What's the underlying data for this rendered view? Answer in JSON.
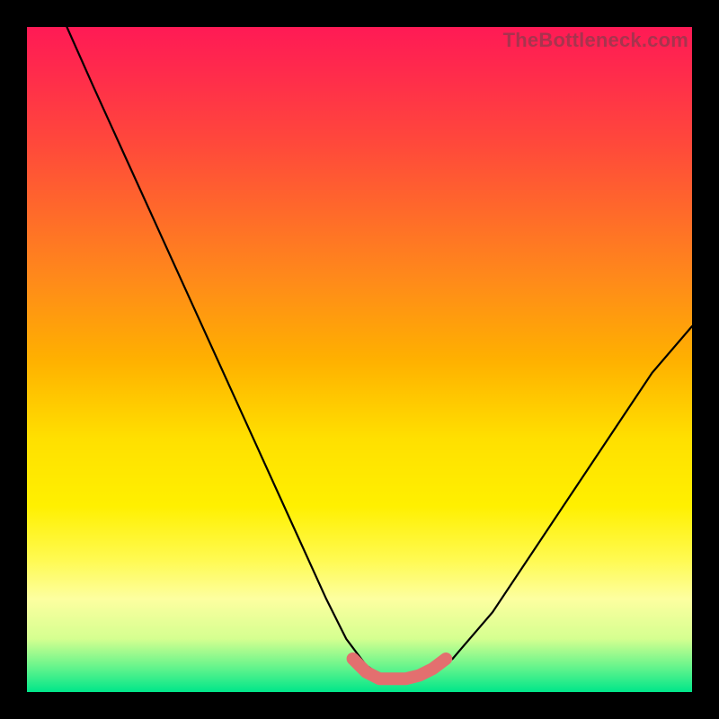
{
  "watermark": "TheBottleneck.com",
  "chart_data": {
    "type": "line",
    "title": "",
    "xlabel": "",
    "ylabel": "",
    "xlim": [
      0,
      100
    ],
    "ylim": [
      0,
      100
    ],
    "series": [
      {
        "name": "bottleneck-curve",
        "x": [
          6,
          10,
          15,
          20,
          25,
          30,
          35,
          40,
          45,
          48,
          51,
          54,
          57,
          60,
          64,
          70,
          76,
          82,
          88,
          94,
          100
        ],
        "values": [
          100,
          91,
          80,
          69,
          58,
          47,
          36,
          25,
          14,
          8,
          4,
          2,
          2,
          2.5,
          5,
          12,
          21,
          30,
          39,
          48,
          55
        ]
      },
      {
        "name": "optimal-band",
        "x": [
          49,
          51,
          53,
          55,
          57,
          59,
          61,
          63
        ],
        "values": [
          5,
          3,
          2,
          2,
          2,
          2.5,
          3.5,
          5
        ]
      }
    ],
    "gradient_stops": [
      {
        "pos": 0,
        "color": "#ff1a55"
      },
      {
        "pos": 18,
        "color": "#ff4a3a"
      },
      {
        "pos": 38,
        "color": "#ff8a1a"
      },
      {
        "pos": 62,
        "color": "#ffe000"
      },
      {
        "pos": 86,
        "color": "#fdffa0"
      },
      {
        "pos": 100,
        "color": "#00e68a"
      }
    ]
  }
}
